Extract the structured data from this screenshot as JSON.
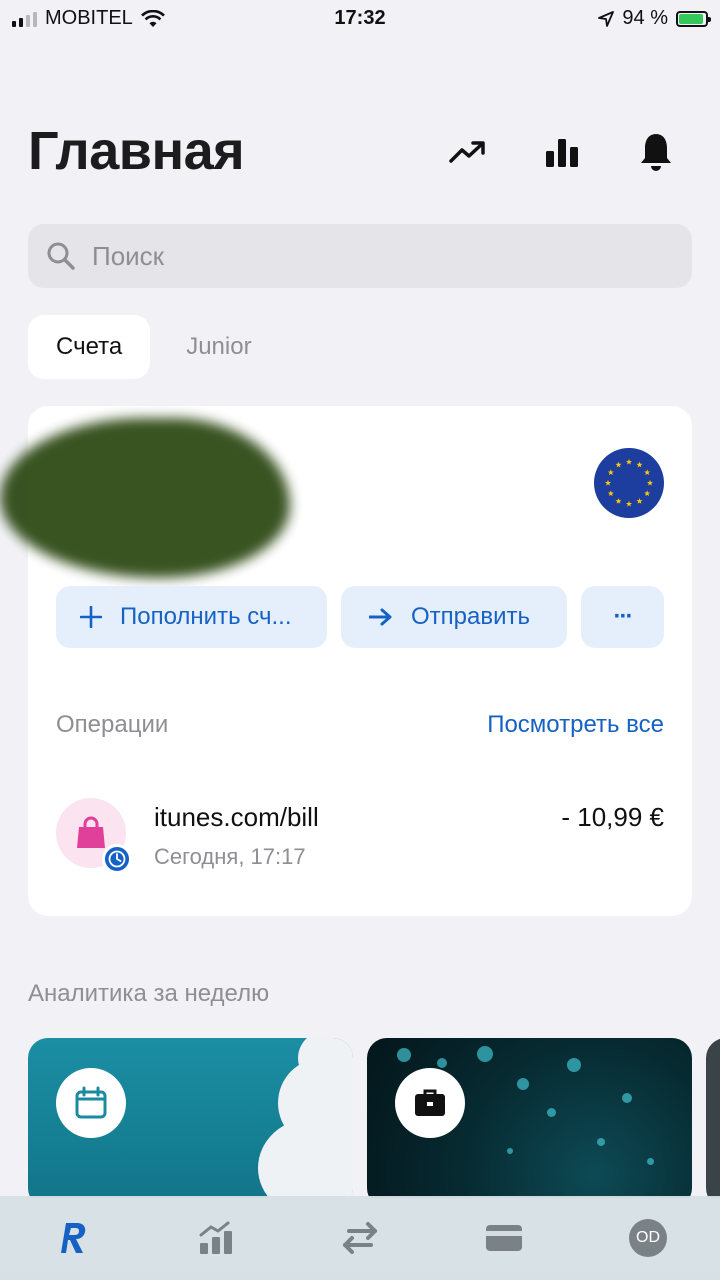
{
  "status_bar": {
    "carrier": "MOBITEL",
    "time": "17:32",
    "battery": "94 %",
    "battery_level": 0.94,
    "icons": [
      "signal-icon",
      "wifi-icon",
      "location-arrow-icon",
      "battery-charging-icon"
    ]
  },
  "header": {
    "title": "Главная",
    "icons": [
      "trending-up-icon",
      "bar-chart-icon",
      "bell-icon"
    ]
  },
  "search": {
    "placeholder": "Поиск",
    "value": ""
  },
  "tabs": [
    {
      "label": "Счета",
      "active": true
    },
    {
      "label": "Junior",
      "active": false
    }
  ],
  "account_card": {
    "currency_flag": "eu-flag-icon",
    "actions": {
      "topup_label": "Пополнить сч...",
      "send_label": "Отправить",
      "more_label": "···"
    },
    "operations_label": "Операции",
    "view_all_label": "Посмотреть все",
    "transaction": {
      "name": "itunes.com/bill",
      "time": "Сегодня, 17:17",
      "amount": "- 10,99 €",
      "icon": "shopping-bag-icon",
      "status_icon": "clock-icon"
    }
  },
  "analytics": {
    "label": "Аналитика за неделю",
    "tiles": [
      {
        "icon": "calendar-icon"
      },
      {
        "icon": "briefcase-icon"
      }
    ]
  },
  "tabbar": {
    "items": [
      "home-r-icon",
      "analytics-icon",
      "transfer-icon",
      "cards-icon"
    ],
    "avatar_initials": "OD"
  },
  "colors": {
    "accent": "#1662c4",
    "background": "#f2f2f6",
    "card": "#ffffff",
    "muted": "#8e8e93",
    "action_bg": "#e5effc"
  }
}
